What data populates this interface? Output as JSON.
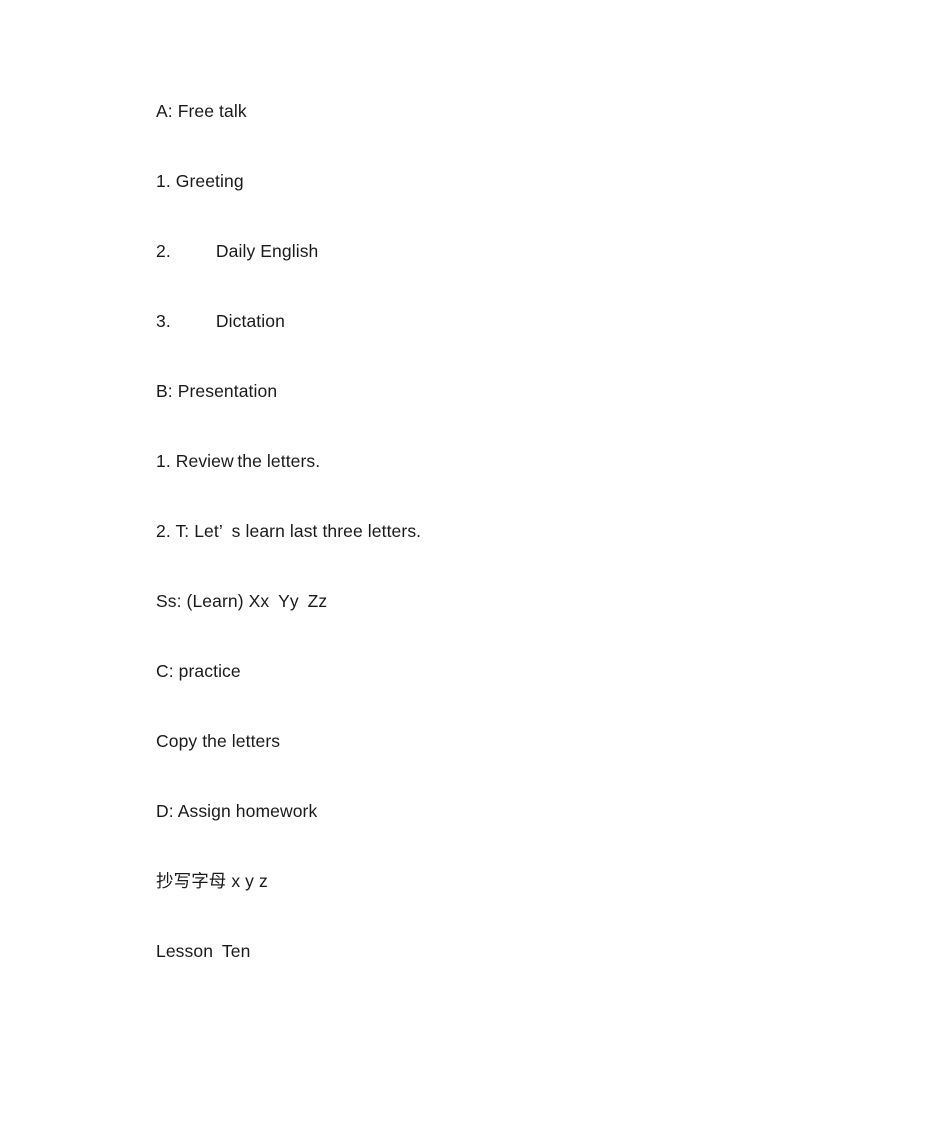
{
  "document": {
    "type": "lesson-plan",
    "background_color": "#ffffff",
    "text_color": "#1a1a1a",
    "lines": [
      {
        "id": "section-a",
        "text": "A: Free talk"
      },
      {
        "id": "item-1-greeting",
        "text": "1. Greeting"
      },
      {
        "id": "item-2-daily-english",
        "text": "2.    Daily English"
      },
      {
        "id": "item-3-dictation",
        "text": "3.    Dictation"
      },
      {
        "id": "section-b",
        "text": "B: Presentation"
      },
      {
        "id": "item-1-review",
        "text": "1. Review the letters."
      },
      {
        "id": "item-2-teacher-line",
        "text": "2. T: Let’ s learn last three letters."
      },
      {
        "id": "students-line",
        "text": "Ss: (Learn) Xx Yy Zz"
      },
      {
        "id": "section-c",
        "text": "C: practice"
      },
      {
        "id": "copy-letters",
        "text": "Copy the letters"
      },
      {
        "id": "section-d",
        "text": "D: Assign homework"
      },
      {
        "id": "homework-chinese",
        "text": "抄写字母 x y z"
      },
      {
        "id": "lesson-title",
        "text": "Lesson Ten"
      }
    ]
  }
}
